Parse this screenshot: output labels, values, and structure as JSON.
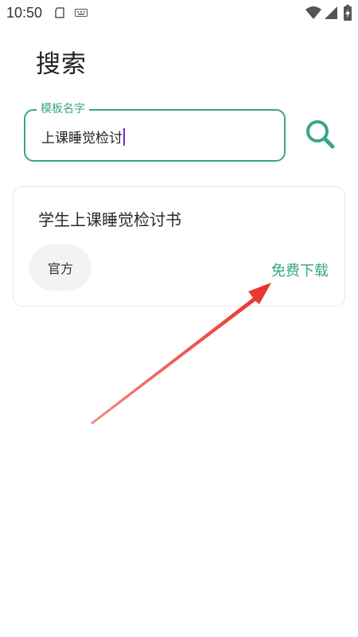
{
  "status_bar": {
    "time": "10:50",
    "icons": [
      "sim-card-icon",
      "keyboard-icon",
      "wifi-icon",
      "signal-icon",
      "battery-charging-icon"
    ]
  },
  "page": {
    "title": "搜索"
  },
  "search": {
    "label": "模板名字",
    "value": "上课睡觉检讨",
    "button_icon": "search-icon"
  },
  "results": [
    {
      "title": "学生上课睡觉检讨书",
      "badge": "官方",
      "action": "免费下载"
    }
  ],
  "colors": {
    "accent": "#3aa48a",
    "cursor": "#6f2bd6",
    "annotation_arrow": "#e8312a"
  }
}
